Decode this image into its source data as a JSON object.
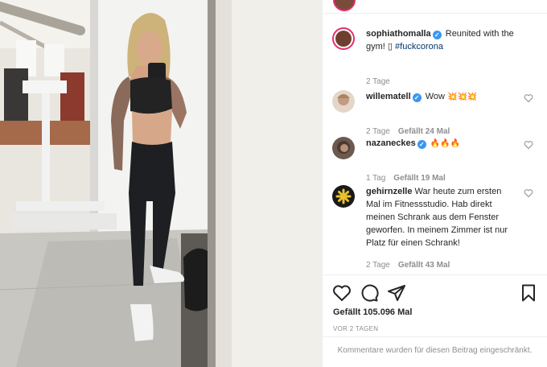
{
  "post": {
    "author": "sophiathomalla",
    "caption_text": "Reunited with the gym! ",
    "caption_glyph": "▯",
    "hashtag": "#fuckcorona",
    "time": "2 Tage"
  },
  "comments": [
    {
      "user": "willematell",
      "verified": true,
      "text": "Wow ",
      "emoji": "💥💥💥",
      "time": "2 Tage",
      "likes": "Gefällt 24 Mal"
    },
    {
      "user": "nazanec​kes",
      "verified": true,
      "text": "",
      "emoji": "🔥🔥🔥",
      "time": "1 Tag",
      "likes": "Gefällt 19 Mal"
    },
    {
      "user": "gehirnzelle",
      "verified": false,
      "text": "War heute zum ersten Mal im Fitnessstudio. Hab direkt meinen Schrank aus dem Fenster geworfen. In meinem Zimmer ist nur Platz für einen Schrank!",
      "emoji": "",
      "time": "2 Tage",
      "likes": "Gefällt 43 Mal"
    }
  ],
  "actions": {
    "like_icon": "heart-icon",
    "comment_icon": "comment-icon",
    "share_icon": "paper-plane-icon",
    "save_icon": "bookmark-icon"
  },
  "likes_summary": "Gefällt 105.096 Mal",
  "posted_ago": "VOR 2 TAGEN",
  "comments_disabled": "Kommentare wurden für diesen Beitrag eingeschränkt.",
  "colors": {
    "verified": "#3897f0",
    "hashtag": "#00376b",
    "muted": "#8e8e8e",
    "story_ring": "#e1306c"
  }
}
